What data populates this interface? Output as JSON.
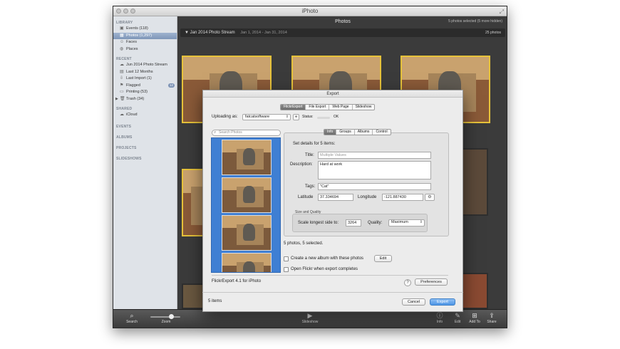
{
  "window": {
    "title": "iPhoto",
    "main_title": "Photos",
    "selected_summary": "5 photos selected (5 more hidden)"
  },
  "sidebar": {
    "library_header": "LIBRARY",
    "library": [
      {
        "label": "Events (118)",
        "icon": "events-icon"
      },
      {
        "label": "Photos (1,297)",
        "icon": "photos-icon",
        "selected": true
      },
      {
        "label": "Faces",
        "icon": "faces-icon"
      },
      {
        "label": "Places",
        "icon": "places-icon"
      }
    ],
    "recent_header": "RECENT",
    "recent": [
      {
        "label": "Jun 2014 Photo Stream",
        "icon": "photostream-icon"
      },
      {
        "label": "Last 12 Months",
        "icon": "calendar-icon"
      },
      {
        "label": "Last Import (1)",
        "icon": "import-icon"
      },
      {
        "label": "Flagged",
        "icon": "flag-icon",
        "badge": "12"
      },
      {
        "label": "Printing (53)",
        "icon": "print-icon"
      },
      {
        "label": "Trash (34)",
        "icon": "trash-icon"
      }
    ],
    "shared_header": "SHARED",
    "shared": [
      {
        "label": "iCloud",
        "icon": "icloud-icon"
      }
    ],
    "events_header": "EVENTS",
    "albums_header": "ALBUMS",
    "projects_header": "PROJECTS",
    "slideshows_header": "SLIDESHOWS"
  },
  "stream": {
    "title": "Jan 2014 Photo Stream",
    "date_range": "Jan 1, 2014 - Jan 31, 2014",
    "count": "25 photos"
  },
  "toolbar": {
    "search": "Search",
    "zoom": "Zoom",
    "slideshow": "Slideshow",
    "info": "Info",
    "edit": "Edit",
    "add_to": "Add To",
    "share": "Share"
  },
  "dialog": {
    "title": "Export",
    "tabs": [
      "FlickrExport",
      "File Export",
      "Web Page",
      "Slideshow"
    ],
    "uploading_as_label": "Uploading as:",
    "account": "fatcatsoftware",
    "status_label": "Status:",
    "status_value": "OK",
    "search_placeholder": "Search Photos",
    "info_tabs": [
      "Info",
      "Groups",
      "Albums",
      "Control"
    ],
    "set_details": "Set details for 5 items:",
    "title_label": "Title:",
    "title_placeholder": "Multiple Values",
    "description_label": "Description:",
    "description_value": "Hard at work",
    "tags_label": "Tags:",
    "tags_value": "\"Cat\"",
    "latitude_label": "Latitude",
    "latitude_value": "37.334694",
    "longitude_label": "Longitude",
    "longitude_value": "-121.887430",
    "size_quality_label": "Size and Quality",
    "scale_label": "Scale longest side to:",
    "scale_value": "3264",
    "quality_label": "Quality:",
    "quality_value": "Maximum",
    "selection_summary": "5 photos, 5 selected.",
    "create_album_label": "Create a new album with these photos",
    "edit_button": "Edit",
    "open_flickr_label": "Open Flickr when export completes",
    "version": "FlickrExport 4.1 for iPhoto",
    "help": "?",
    "preferences": "Preferences",
    "items": "5 items",
    "cancel": "Cancel",
    "export": "Export"
  }
}
